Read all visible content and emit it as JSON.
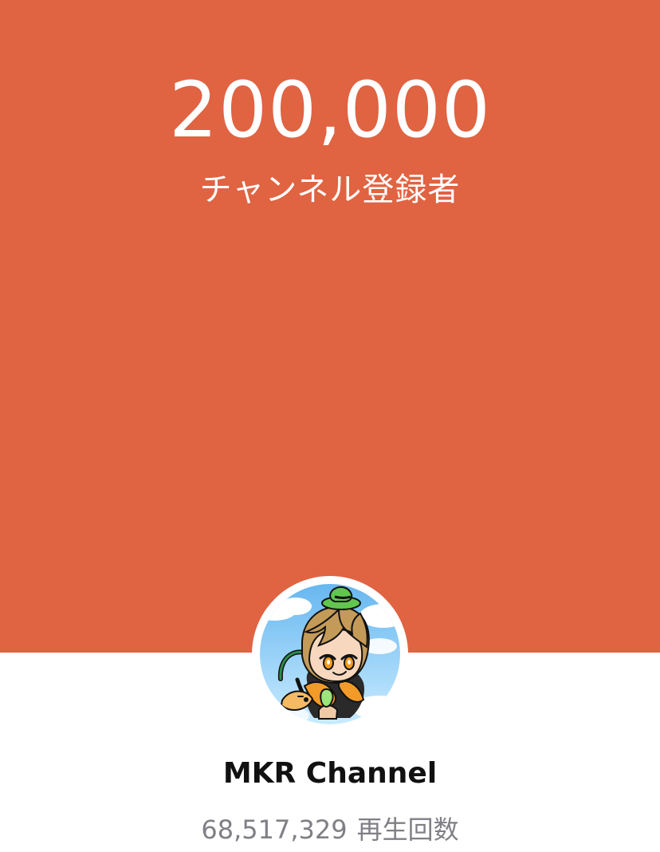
{
  "banner": {
    "milestone_number": "200,000",
    "milestone_label": "チャンネル登録者",
    "background_color": "#e06342"
  },
  "channel": {
    "avatar_icon": "channel-avatar-icon",
    "name": "MKR Channel",
    "views_count": "68,517,329",
    "views_label": "再生回数"
  },
  "colors": {
    "text_on_banner": "#ffffff",
    "name_text": "#111111",
    "secondary_text": "#7f7f86"
  }
}
